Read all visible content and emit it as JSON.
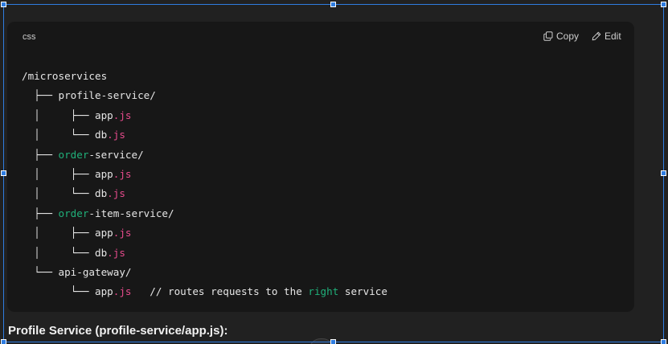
{
  "code_block": {
    "language": "css",
    "copy_label": "Copy",
    "edit_label": "Edit",
    "lines": [
      [
        {
          "t": "/microservices",
          "c": "text"
        }
      ],
      [
        {
          "t": "  ├── ",
          "c": "tree"
        },
        {
          "t": "profile-service/",
          "c": "text"
        }
      ],
      [
        {
          "t": "  │     ├── ",
          "c": "tree"
        },
        {
          "t": "app",
          "c": "text"
        },
        {
          "t": ".js",
          "c": "ext"
        }
      ],
      [
        {
          "t": "  │     └── ",
          "c": "tree"
        },
        {
          "t": "db",
          "c": "text"
        },
        {
          "t": ".js",
          "c": "ext"
        }
      ],
      [
        {
          "t": "  ├── ",
          "c": "tree"
        },
        {
          "t": "order",
          "c": "green"
        },
        {
          "t": "-service/",
          "c": "text"
        }
      ],
      [
        {
          "t": "  │     ├── ",
          "c": "tree"
        },
        {
          "t": "app",
          "c": "text"
        },
        {
          "t": ".js",
          "c": "ext"
        }
      ],
      [
        {
          "t": "  │     └── ",
          "c": "tree"
        },
        {
          "t": "db",
          "c": "text"
        },
        {
          "t": ".js",
          "c": "ext"
        }
      ],
      [
        {
          "t": "  ├── ",
          "c": "tree"
        },
        {
          "t": "order",
          "c": "green"
        },
        {
          "t": "-item-service/",
          "c": "text"
        }
      ],
      [
        {
          "t": "  │     ├── ",
          "c": "tree"
        },
        {
          "t": "app",
          "c": "text"
        },
        {
          "t": ".js",
          "c": "ext"
        }
      ],
      [
        {
          "t": "  │     └── ",
          "c": "tree"
        },
        {
          "t": "db",
          "c": "text"
        },
        {
          "t": ".js",
          "c": "ext"
        }
      ],
      [
        {
          "t": "  └── ",
          "c": "tree"
        },
        {
          "t": "api-gateway/",
          "c": "text"
        }
      ],
      [
        {
          "t": "        └── ",
          "c": "tree"
        },
        {
          "t": "app",
          "c": "text"
        },
        {
          "t": ".js",
          "c": "ext"
        },
        {
          "t": "   // routes requests to the ",
          "c": "comment"
        },
        {
          "t": "right",
          "c": "green"
        },
        {
          "t": " service",
          "c": "comment"
        }
      ]
    ]
  },
  "section_heading": "Profile Service (profile-service/app.js):",
  "colors": {
    "background": "#212121",
    "code_background": "#171717",
    "accent_selection": "#2f7de1",
    "extension_pink": "#e64b8c",
    "keyword_green": "#20b07a"
  },
  "icons": {
    "copy": "copy-icon",
    "edit": "edit-icon"
  }
}
